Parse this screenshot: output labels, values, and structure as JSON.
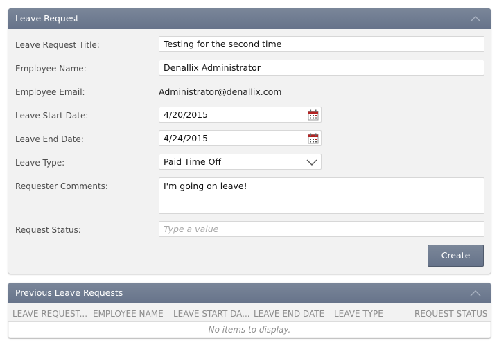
{
  "form": {
    "title": "Leave Request",
    "fields": {
      "title_label": "Leave Request Title:",
      "title_value": "Testing for the second time",
      "name_label": "Employee Name:",
      "name_value": "Denallix Administrator",
      "email_label": "Employee Email:",
      "email_value": "Administrator@denallix.com",
      "start_label": "Leave Start Date:",
      "start_value": "4/20/2015",
      "end_label": "Leave End Date:",
      "end_value": "4/24/2015",
      "type_label": "Leave Type:",
      "type_value": "Paid Time Off",
      "comments_label": "Requester Comments:",
      "comments_value": "I'm going on leave!",
      "status_label": "Request Status:",
      "status_placeholder": "Type a value"
    },
    "create_label": "Create"
  },
  "grid": {
    "title": "Previous Leave Requests",
    "columns": [
      "LEAVE REQUEST...",
      "EMPLOYEE NAME",
      "LEAVE START DA...",
      "LEAVE END DATE",
      "LEAVE TYPE",
      "REQUEST STATUS"
    ],
    "empty_message": "No items to display."
  },
  "colors": {
    "header": "#6b778c",
    "panel_bg": "#f2f2f2",
    "calendar_accent": "#b22222"
  },
  "icons": {
    "collapse": "chevron-up-icon",
    "calendar": "calendar-icon",
    "dropdown": "chevron-down-icon"
  }
}
